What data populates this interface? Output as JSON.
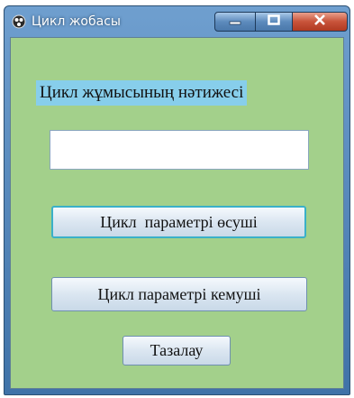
{
  "window": {
    "title": "Цикл жобасы",
    "icon": "app-icon",
    "controls": {
      "minimize_icon": "minimize-icon",
      "maximize_icon": "maximize-icon",
      "close_icon": "close-icon"
    }
  },
  "form": {
    "label": "Цикл жұмысының нәтижесі",
    "result_input_value": "",
    "buttons": {
      "increase": "Цикл  параметрі өсуші",
      "decrease": "Цикл параметрі кемуші",
      "clear": "Тазалау"
    }
  },
  "colors": {
    "form_background": "#a3d08b",
    "label_background": "#87ceeb",
    "title_bar": "#4a78aa"
  }
}
